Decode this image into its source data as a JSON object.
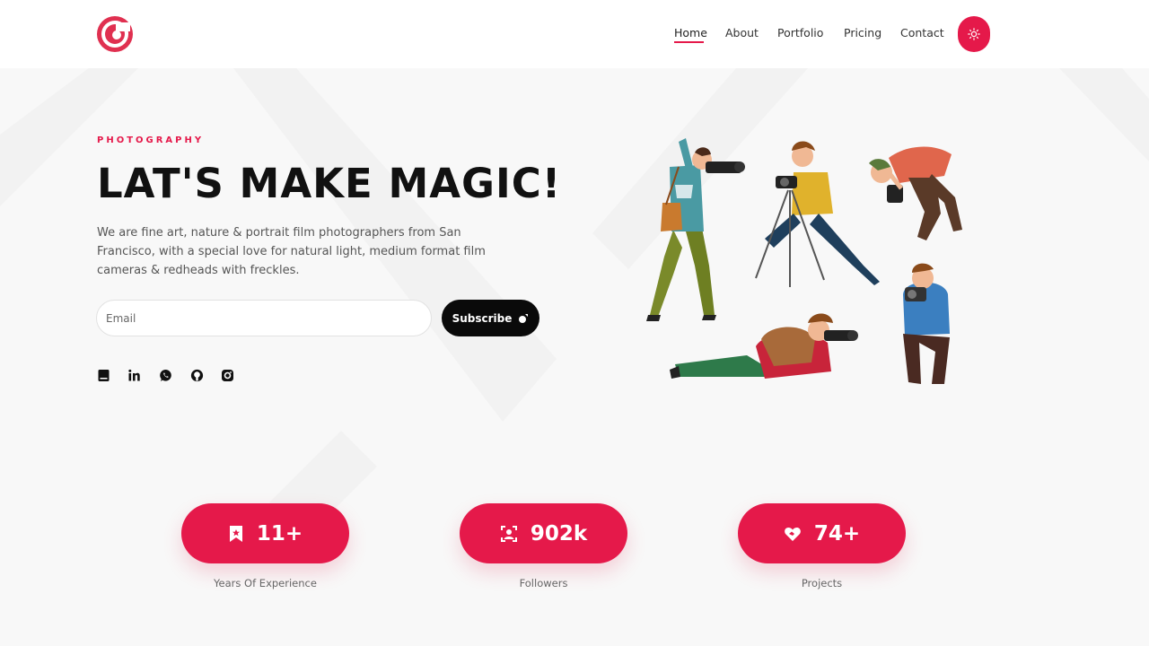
{
  "nav": {
    "items": [
      {
        "label": "Home"
      },
      {
        "label": "About"
      },
      {
        "label": "Portfolio"
      },
      {
        "label": "Pricing"
      },
      {
        "label": "Contact"
      }
    ],
    "active_index": 0,
    "theme_icon": "sun-icon"
  },
  "hero": {
    "eyebrow": "PHOTOGRAPHY",
    "title": "LAT'S MAKE MAGIC!",
    "description": "We are fine art, nature & portrait film photographers from San Francisco, with a special love for natural light, medium format film cameras & redheads with freckles."
  },
  "subscribe": {
    "email_placeholder": "Email",
    "email_value": "",
    "button_label": "Subscribe",
    "button_icon": "paper-plane-icon"
  },
  "socials": [
    {
      "icon": "book-icon"
    },
    {
      "icon": "linkedin-icon"
    },
    {
      "icon": "whatsapp-icon"
    },
    {
      "icon": "github-icon"
    },
    {
      "icon": "instagram-icon"
    }
  ],
  "stats": [
    {
      "value": "11+",
      "label": "Years Of Experience",
      "icon": "bookmark-icon"
    },
    {
      "value": "902k",
      "label": "Followers",
      "icon": "user-focus-icon"
    },
    {
      "value": "74+",
      "label": "Projects",
      "icon": "heart-handshake-icon"
    }
  ],
  "colors": {
    "accent": "#e5194a",
    "dark": "#0a0a0a",
    "background": "#f8f8f8"
  }
}
